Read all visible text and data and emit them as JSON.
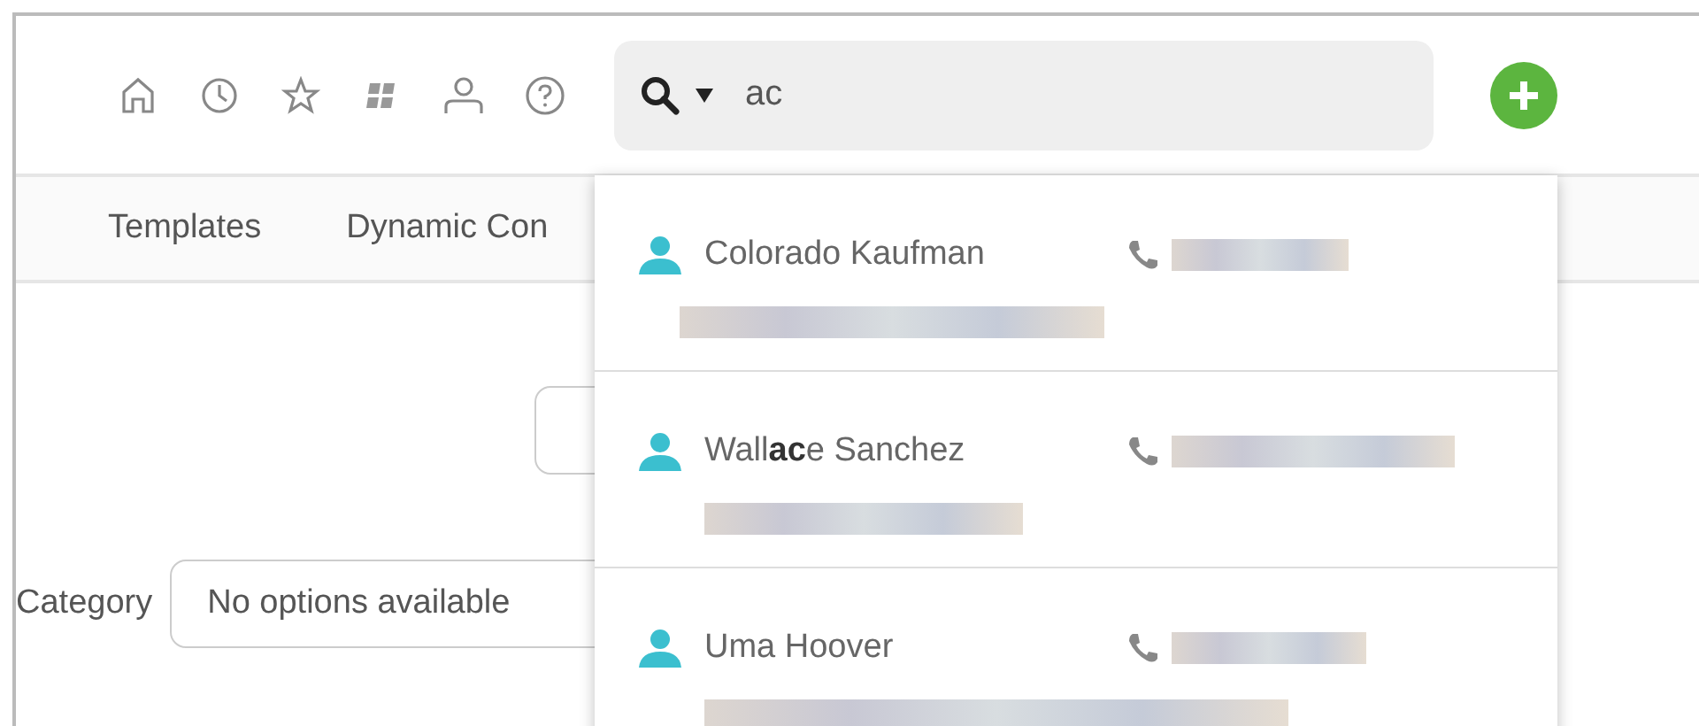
{
  "search": {
    "value": "ac"
  },
  "nav": [
    {
      "label": "Templates"
    },
    {
      "label": "Dynamic Con"
    }
  ],
  "category": {
    "label": "Category",
    "value": "No options available"
  },
  "results": [
    {
      "name": "Colorado Kaufman"
    },
    {
      "name": "Wall**ac**e Sanchez"
    },
    {
      "name": "Uma Hoover"
    }
  ]
}
